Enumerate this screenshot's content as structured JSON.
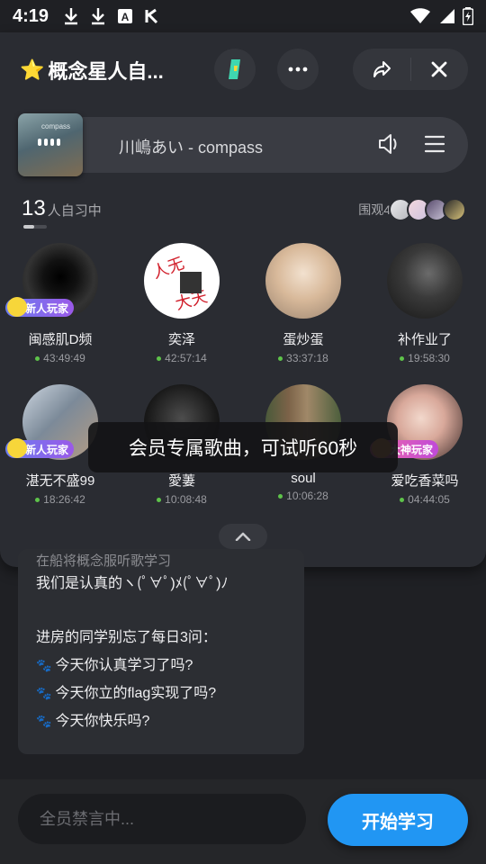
{
  "status_bar": {
    "time": "4:19"
  },
  "header": {
    "star_icon": "⭐",
    "title": "概念星人自..."
  },
  "music": {
    "song": "川嶋あい - compass",
    "album_label": "compass"
  },
  "study": {
    "count": "13",
    "count_label": "人自习中",
    "spectators_label": "围观4"
  },
  "users": [
    {
      "name": "闽感肌D频",
      "time": "43:49:49",
      "badge": "新人玩家"
    },
    {
      "name": "奕泽",
      "time": "42:57:14"
    },
    {
      "name": "蛋炒蛋",
      "time": "33:37:18"
    },
    {
      "name": "补作业了",
      "time": "19:58:30"
    },
    {
      "name": "湛无不盛99",
      "time": "18:26:42",
      "badge": "新人玩家"
    },
    {
      "name": "愛萋",
      "time": "10:08:48"
    },
    {
      "name": "soul",
      "time": "10:06:28"
    },
    {
      "name": "爱吃香菜吗",
      "time": "04:44:05",
      "badge": "大神玩家"
    }
  ],
  "toast": "会员专属歌曲，可试听60秒",
  "chat": {
    "cut_line": "在船将概念服听歌学习",
    "line1": "我们是认真的ヽ(ﾟ∀ﾟ)ﾒ(ﾟ∀ﾟ)ﾉ",
    "line2": "进房的同学别忘了每日3问：",
    "q1": "今天你认真学习了吗?",
    "q2": "今天你立的flag实现了吗?",
    "q3": "今天你快乐吗?"
  },
  "input": {
    "placeholder": "全员禁言中..."
  },
  "start_button": "开始学习"
}
